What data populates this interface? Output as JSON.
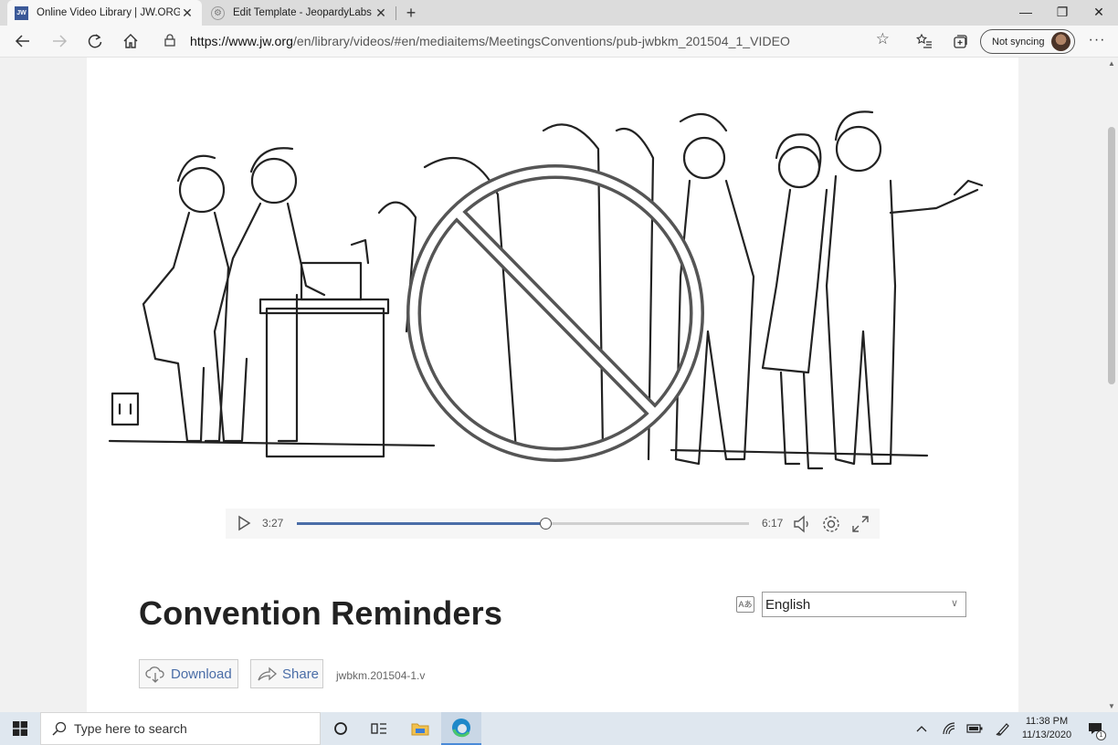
{
  "browser": {
    "tabs": [
      {
        "title": "Online Video Library | JW.ORG Vi",
        "favicon": "jw-logo-icon",
        "active": true
      },
      {
        "title": "Edit Template - JeopardyLabs",
        "favicon": "jeopardylabs-icon",
        "active": false
      }
    ],
    "url_host": "https://www.jw.org",
    "url_path": "/en/library/videos/#en/mediaitems/MeetingsConventions/pub-jwbkm_201504_1_VIDEO",
    "sync_label": "Not syncing"
  },
  "player": {
    "current_time": "3:27",
    "duration": "6:17",
    "progress": 0.55
  },
  "video_page": {
    "title": "Convention Reminders",
    "language": "English",
    "download_label": "Download",
    "share_label": "Share",
    "file_id": "jwbkm.201504-1.v"
  },
  "taskbar": {
    "search_placeholder": "Type here to search",
    "time": "11:38 PM",
    "date": "11/13/2020",
    "notification_count": "1"
  },
  "colors": {
    "accent": "#4a6da7",
    "taskbar": "#dfe7ef"
  }
}
